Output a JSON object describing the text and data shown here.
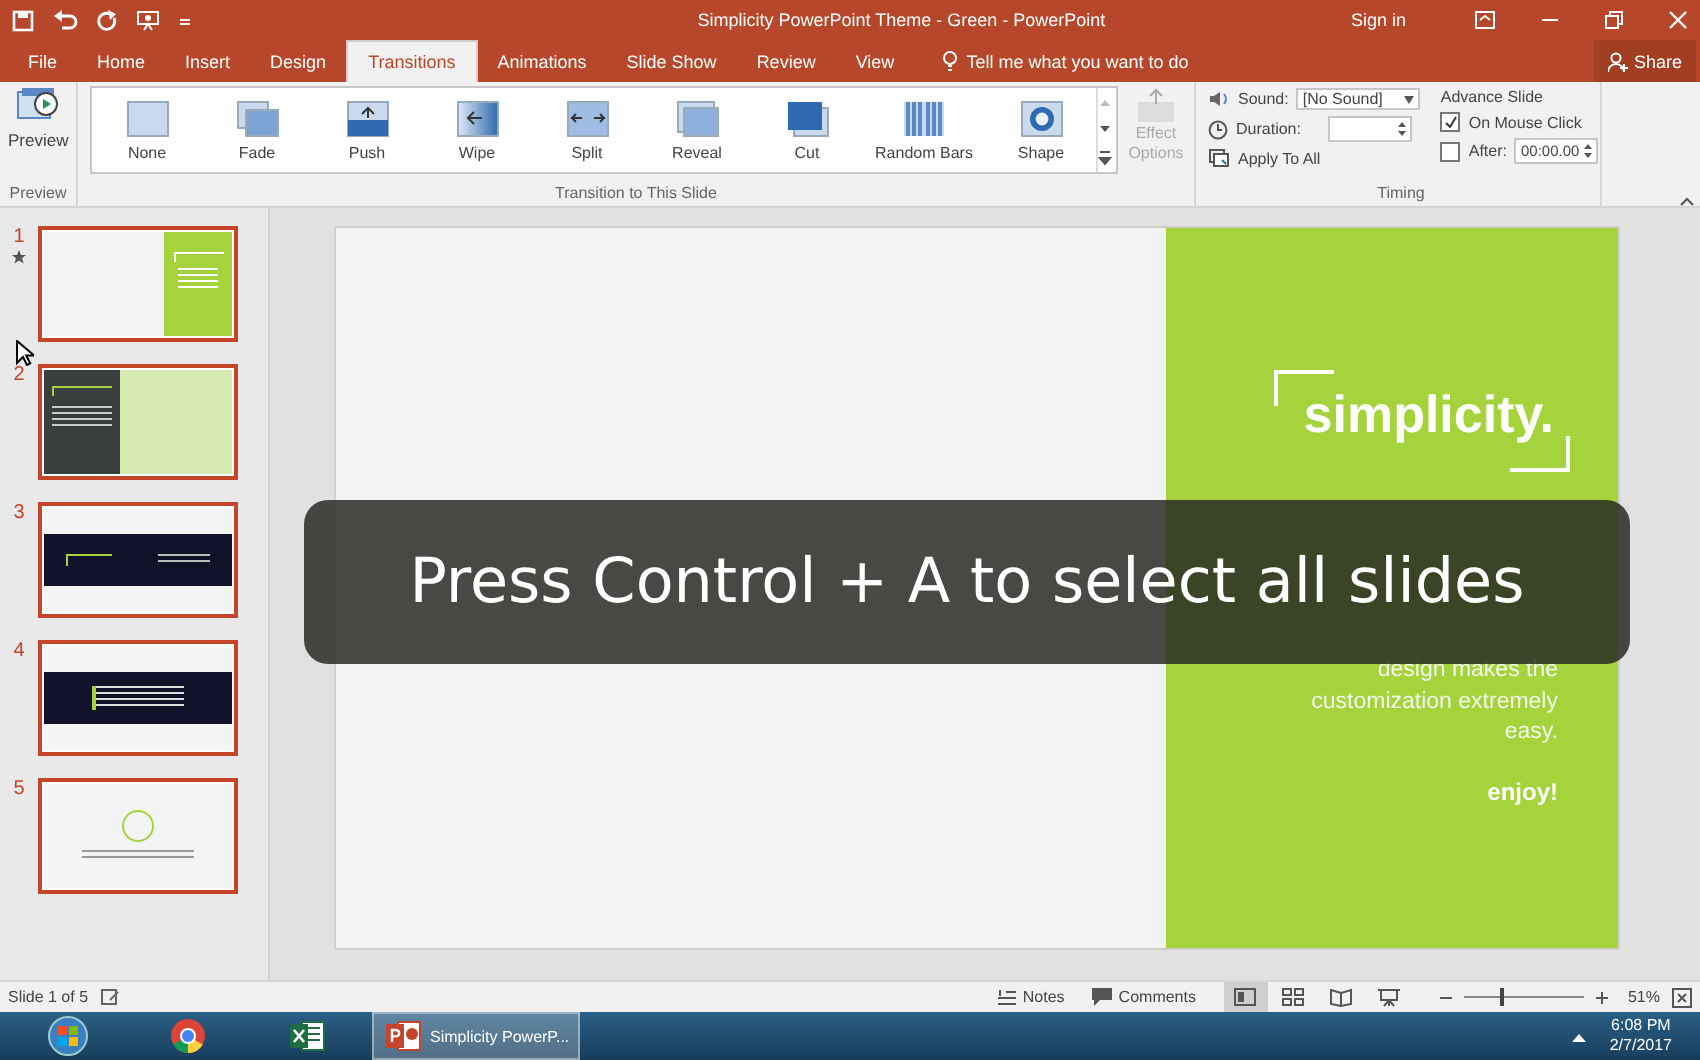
{
  "window": {
    "title": "Simplicity PowerPoint Theme - Green  -  PowerPoint",
    "sign_in": "Sign in"
  },
  "tabs": [
    {
      "label": "File",
      "selected": false
    },
    {
      "label": "Home",
      "selected": false
    },
    {
      "label": "Insert",
      "selected": false
    },
    {
      "label": "Design",
      "selected": false
    },
    {
      "label": "Transitions",
      "selected": true
    },
    {
      "label": "Animations",
      "selected": false
    },
    {
      "label": "Slide Show",
      "selected": false
    },
    {
      "label": "Review",
      "selected": false
    },
    {
      "label": "View",
      "selected": false
    }
  ],
  "tell_me": {
    "placeholder": "Tell me what you want to do"
  },
  "share": "Share",
  "ribbon": {
    "preview": {
      "label": "Preview",
      "group": "Preview"
    },
    "transitions": [
      {
        "label": "None",
        "kind": "none",
        "selected": false
      },
      {
        "label": "Fade",
        "kind": "fade",
        "selected": false
      },
      {
        "label": "Push",
        "kind": "push",
        "selected": false
      },
      {
        "label": "Wipe",
        "kind": "wipe",
        "selected": false
      },
      {
        "label": "Split",
        "kind": "split",
        "selected": false
      },
      {
        "label": "Reveal",
        "kind": "reveal",
        "selected": false
      },
      {
        "label": "Cut",
        "kind": "cut",
        "selected": false
      },
      {
        "label": "Random Bars",
        "kind": "bars",
        "selected": false
      },
      {
        "label": "Shape",
        "kind": "shape",
        "selected": false
      }
    ],
    "transitions_group": "Transition to This Slide",
    "effect_options": {
      "label": "Effect Options",
      "disabled": true
    },
    "timing": {
      "sound_label": "Sound:",
      "sound_value": "[No Sound]",
      "duration_label": "Duration:",
      "apply_all": "Apply To All",
      "advance_title": "Advance Slide",
      "on_click": {
        "label": "On Mouse Click",
        "checked": true
      },
      "after": {
        "label": "After:",
        "checked": false,
        "value": "00:00.00"
      },
      "group": "Timing"
    }
  },
  "thumbnails": [
    {
      "number": "1",
      "kind": "green-right",
      "selected": true,
      "has_transition": true
    },
    {
      "number": "2",
      "kind": "dark-left",
      "selected": true,
      "has_transition": false
    },
    {
      "number": "3",
      "kind": "dark-band",
      "selected": true,
      "has_transition": false
    },
    {
      "number": "4",
      "kind": "dark-quote",
      "selected": true,
      "has_transition": false
    },
    {
      "number": "5",
      "kind": "circle",
      "selected": true,
      "has_transition": false
    }
  ],
  "slide": {
    "title": "simplicity.",
    "lines": [
      "design makes the",
      "customization extremely",
      "easy."
    ],
    "closing": "enjoy!"
  },
  "caption": "Press Control + A to select all slides",
  "status_bar": {
    "slide": "Slide 1 of 5",
    "notes": "Notes",
    "comments": "Comments",
    "views": [
      {
        "kind": "normal",
        "selected": true
      },
      {
        "kind": "sorter",
        "selected": false
      },
      {
        "kind": "reading",
        "selected": false
      },
      {
        "kind": "show",
        "selected": false
      }
    ],
    "zoom": {
      "level": 0.3
    },
    "zoom_text": "51%"
  },
  "taskbar": {
    "items": [
      {
        "kind": "start",
        "selected": false
      },
      {
        "kind": "browser",
        "selected": false
      },
      {
        "kind": "excel",
        "selected": false
      },
      {
        "kind": "powerpoint",
        "label": "Simplicity PowerP...",
        "selected": true
      }
    ],
    "time": "6:08 PM",
    "date": "2/7/2017"
  }
}
